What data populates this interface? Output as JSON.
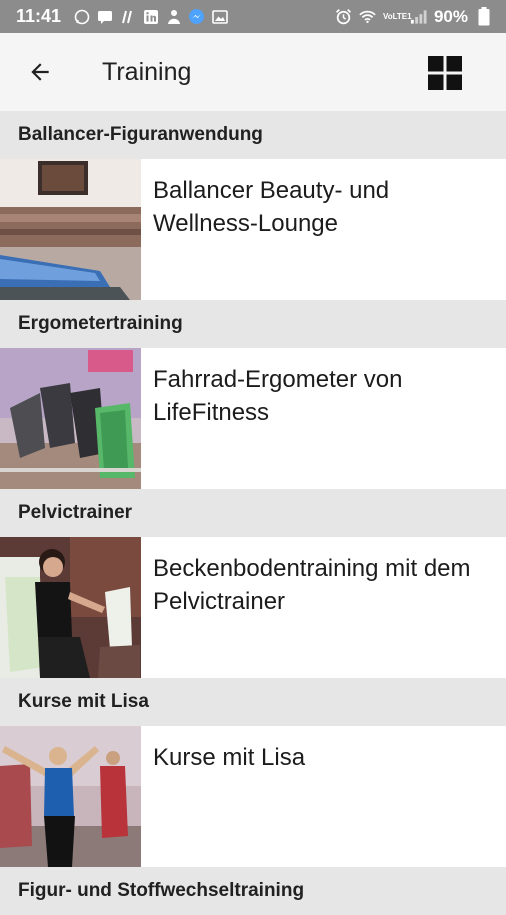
{
  "status_bar": {
    "time": "11:41",
    "battery": "90%",
    "network_label": "VoLTE1"
  },
  "app_bar": {
    "title": "Training",
    "back_icon": "arrow-left-icon",
    "view_icon": "grid-view-icon"
  },
  "sections": [
    {
      "header": "Ballancer-Figuranwendung",
      "item": "Ballancer Beauty- und Wellness-Lounge"
    },
    {
      "header": "Ergometertraining",
      "item": "Fahrrad-Ergometer von LifeFitness"
    },
    {
      "header": "Pelvictrainer",
      "item": "Beckenbodentraining mit dem Pelvictrainer"
    },
    {
      "header": "Kurse mit Lisa",
      "item": "Kurse mit Lisa"
    },
    {
      "header": "Figur- und Stoffwechseltraining"
    }
  ]
}
